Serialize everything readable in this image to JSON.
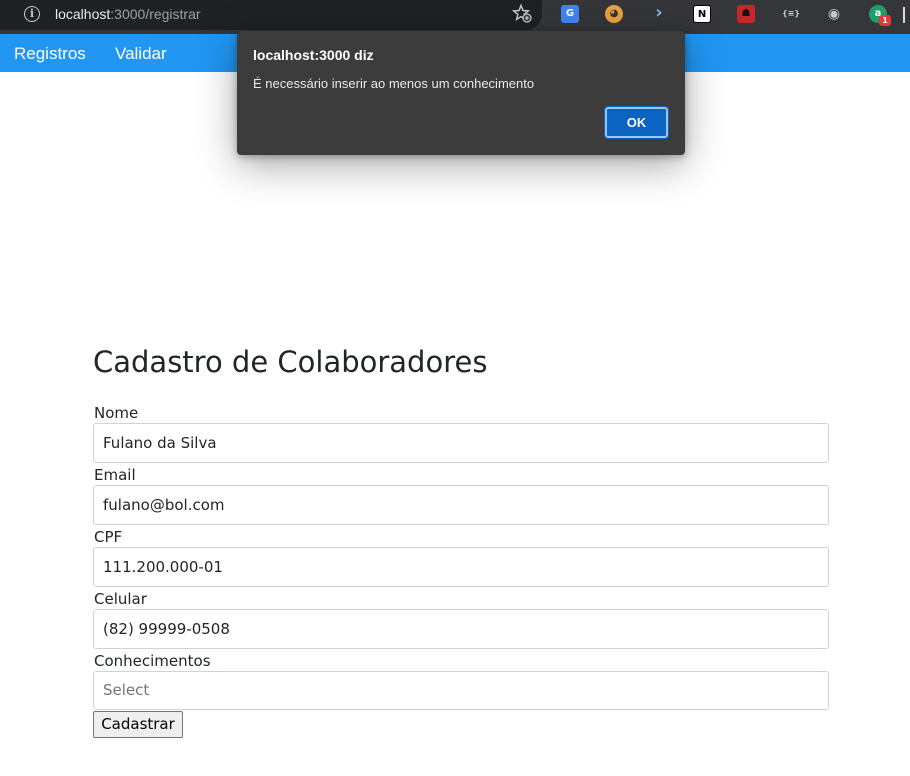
{
  "browser": {
    "url_host": "localhost",
    "url_rest": ":3000",
    "url_path": "/registrar",
    "extensions": [
      {
        "name": "google-translate-icon",
        "glyph": "G",
        "color": "#4285f4"
      },
      {
        "name": "owl-extension-icon",
        "glyph": "◕",
        "color": "#e8a33d"
      },
      {
        "name": "arrow-extension-icon",
        "glyph": "›",
        "color": "#35363a"
      },
      {
        "name": "notion-icon",
        "glyph": "N",
        "color": "#ffffff"
      },
      {
        "name": "mask-extension-icon",
        "glyph": "☗",
        "color": "#c62828"
      },
      {
        "name": "braces-extension-icon",
        "glyph": "{≡}",
        "color": "#35363a"
      },
      {
        "name": "camera-extension-icon",
        "glyph": "◉",
        "color": "#35363a"
      },
      {
        "name": "green-extension-icon",
        "glyph": "a",
        "color": "#1e9e6a",
        "badge": "1"
      }
    ]
  },
  "nav": {
    "items": [
      "Registros",
      "Validar"
    ]
  },
  "form": {
    "title": "Cadastro de Colaboradores",
    "fields": [
      {
        "label": "Nome",
        "value": "Fulano da Silva"
      },
      {
        "label": "Email",
        "value": "fulano@bol.com"
      },
      {
        "label": "CPF",
        "value": "111.200.000-01"
      },
      {
        "label": "Celular",
        "value": "(82) 99999-0508"
      },
      {
        "label": "Conhecimentos",
        "placeholder": "Select"
      }
    ],
    "submit_label": "Cadastrar"
  },
  "alert": {
    "title": "localhost:3000 diz",
    "message": "É necessário inserir ao menos um conhecimento",
    "ok_label": "OK"
  },
  "colors": {
    "nav_bg": "#2196f3",
    "dialog_bg": "#3c3c3c",
    "ok_button": "#0b63c4"
  }
}
